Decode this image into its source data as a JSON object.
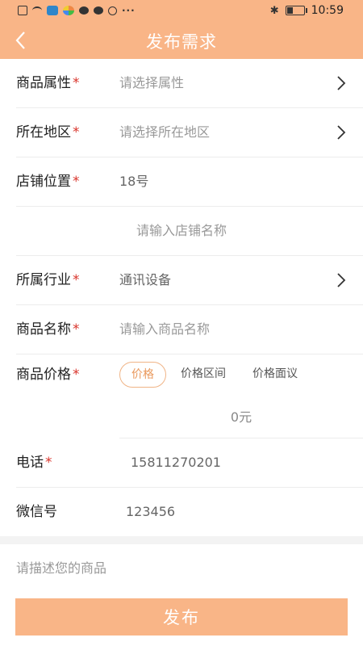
{
  "status_bar": {
    "time": "10:59",
    "more": "···",
    "battery_level": 0.4,
    "icons": [
      "sim-icon",
      "wifi-icon",
      "app-icon",
      "colorful-app-icon",
      "wechat-icon",
      "chat-icon",
      "ring-icon"
    ],
    "bluetooth": "✱"
  },
  "header": {
    "title": "发布需求",
    "back_icon": "chevron-left-icon",
    "bg_color": "#f9b587"
  },
  "form": {
    "required_mark": "*",
    "attribute": {
      "label": "商品属性",
      "placeholder": "请选择属性"
    },
    "region": {
      "label": "所在地区",
      "placeholder": "请选择所在地区"
    },
    "shop_location": {
      "label": "店铺位置",
      "value": "18号"
    },
    "shop_name": {
      "placeholder": "请输入店铺名称"
    },
    "industry": {
      "label": "所属行业",
      "value": "通讯设备"
    },
    "product_name": {
      "label": "商品名称",
      "placeholder": "请输入商品名称"
    },
    "price": {
      "label": "商品价格",
      "options": [
        "价格",
        "价格区间",
        "价格面议"
      ],
      "selected": "价格",
      "value": "0元"
    },
    "phone": {
      "label": "电话",
      "value": "15811270201"
    },
    "wechat": {
      "label": "微信号",
      "value": "123456"
    },
    "description": {
      "placeholder": "请描述您的商品"
    }
  },
  "submit_label": "发布",
  "accent_color": "#f9b587",
  "required_color": "#d9342b"
}
